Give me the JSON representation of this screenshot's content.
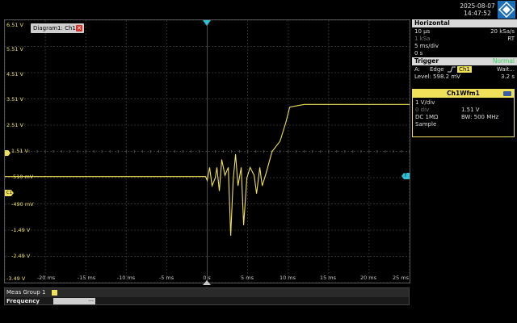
{
  "header": {
    "date": "2025-08-07",
    "time": "14:47:52",
    "logo_icon": "rohde-schwarz-logo"
  },
  "diagram": {
    "tab_label": "Diagram1: Ch1",
    "close_glyph": "✕"
  },
  "axes": {
    "y_labels": [
      "6.51 V",
      "5.51 V",
      "4.51 V",
      "3.51 V",
      "2.51 V",
      "1.51 V",
      "510 mV",
      "-490 mV",
      "-1.49 V",
      "-2.49 V",
      "-3.49 V"
    ],
    "x_labels": [
      "-20 ms",
      "-15 ms",
      "-10 ms",
      "-5 ms",
      "0 s",
      "5 ms",
      "10 ms",
      "15 ms",
      "20 ms",
      "25 ms"
    ]
  },
  "markers": {
    "trigger_label": "T",
    "offset_label": "O",
    "ch_marker": "C1"
  },
  "chart_data": {
    "type": "line",
    "x_unit": "ms",
    "y_unit": "V",
    "xlim": [
      -25,
      25
    ],
    "ylim": [
      -3.49,
      6.51
    ],
    "grid": true,
    "series": [
      {
        "color": "#f0e05a",
        "x": [
          -25,
          -0.2,
          0,
          0.3,
          0.6,
          1.0,
          1.2,
          1.5,
          1.8,
          2.2,
          2.6,
          2.9,
          3.2,
          3.5,
          3.8,
          4.2,
          4.5,
          4.9,
          5.3,
          5.8,
          6.1,
          6.5,
          6.8,
          7.3,
          8.0,
          9.0,
          9.7,
          10.2,
          12,
          15,
          20,
          25
        ],
        "y": [
          0.55,
          0.55,
          0.4,
          0.9,
          0.2,
          0.5,
          0.9,
          0.0,
          1.2,
          0.6,
          0.9,
          -1.7,
          0.4,
          1.4,
          0.2,
          0.9,
          -1.3,
          0.5,
          0.9,
          0.6,
          -0.1,
          0.9,
          0.2,
          0.7,
          1.5,
          1.9,
          2.6,
          3.2,
          3.3,
          3.3,
          3.3,
          3.3
        ]
      }
    ]
  },
  "measurement": {
    "group_title": "Meas Group 1",
    "badge_label": "1",
    "label": "Frequency",
    "value": "---"
  },
  "horizontal": {
    "title": "Horizontal",
    "time_scale": "10 µs",
    "sample_rate": "20 kSa/s",
    "record_length": "1 kSa",
    "mode": "RT",
    "time_per_div": "5 ms/div",
    "position": "0 s"
  },
  "trigger": {
    "title": "Trigger",
    "status": "Normal",
    "source_prefix": "A:",
    "type": "Edge",
    "source": "Ch1",
    "state": "Wait...",
    "level": "Level: 598.2 mV",
    "holdoff": "3.2 s"
  },
  "channel": {
    "title": "Ch1Wfm1",
    "scale": "1 V/div",
    "offset_label": "0 div",
    "position": "1.51 V",
    "coupling": "DC 1MΩ",
    "bandwidth": "BW: 500 MHz",
    "acq": "Sample"
  },
  "colors": {
    "waveform": "#f0e05a",
    "accent_cyan": "#2cc2d6",
    "status_green": "#3ad65a"
  }
}
